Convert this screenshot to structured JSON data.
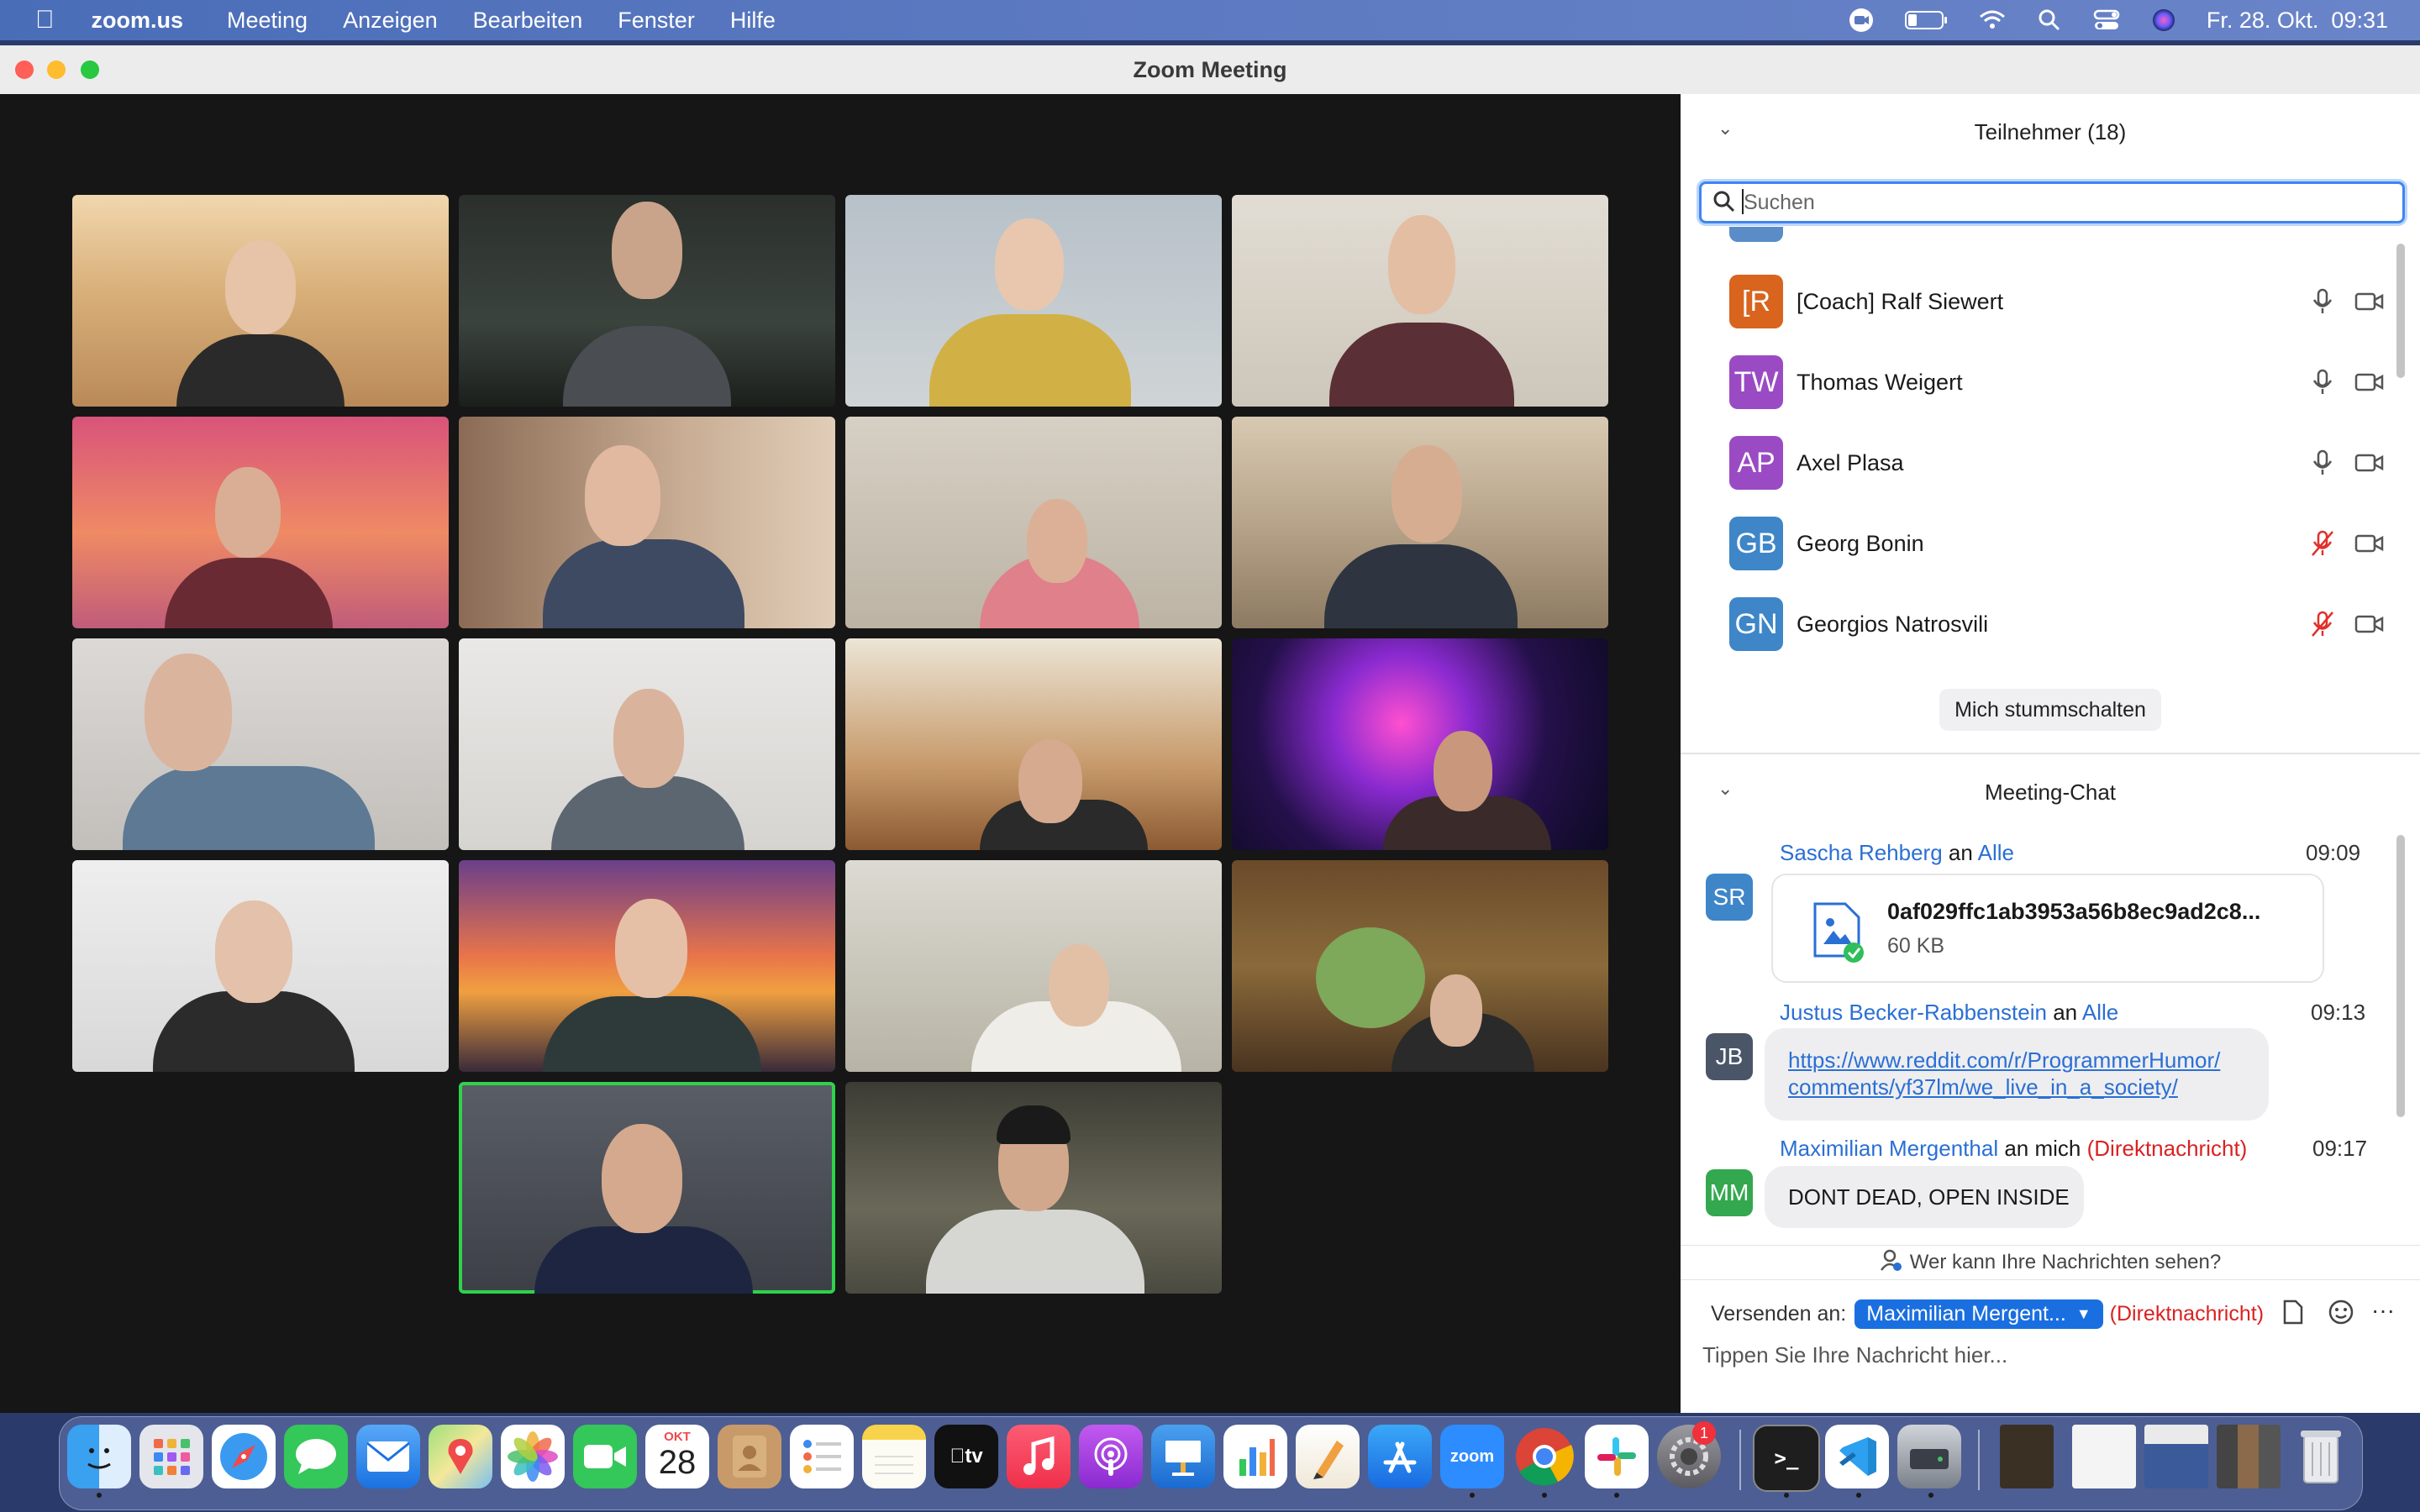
{
  "menubar": {
    "app_name": "zoom.us",
    "menus": [
      "Meeting",
      "Anzeigen",
      "Bearbeiten",
      "Fenster",
      "Hilfe"
    ],
    "clock": "Fr. 28. Okt.  09:31"
  },
  "window": {
    "title": "Zoom Meeting"
  },
  "participants_panel": {
    "title": "Teilnehmer (18)",
    "search_placeholder": "Suchen",
    "participants": [
      {
        "initials": "[R",
        "name": "[Coach] Ralf Siewert",
        "color": "#d8641e",
        "muted": false
      },
      {
        "initials": "TW",
        "name": "Thomas Weigert",
        "color": "#9a4bc4",
        "muted": false
      },
      {
        "initials": "AP",
        "name": "Axel Plasa",
        "color": "#9a4bc4",
        "muted": false
      },
      {
        "initials": "GB",
        "name": "Georg Bonin",
        "color": "#3e86c8",
        "muted": true
      },
      {
        "initials": "GN",
        "name": "Georgios Natrosvili",
        "color": "#3e86c8",
        "muted": true
      }
    ],
    "mute_button": "Mich stummschalten"
  },
  "chat": {
    "title": "Meeting-Chat",
    "messages": [
      {
        "initials": "SR",
        "sender": "Sascha Rehberg",
        "to_word": "an",
        "recipient": "Alle",
        "time": "09:09",
        "file_name": "0af029ffc1ab3953a56b8ec9ad2c8...",
        "file_size": "60 KB"
      },
      {
        "initials": "JB",
        "sender": "Justus Becker-Rabbenstein",
        "to_word": "an",
        "recipient": "Alle",
        "time": "09:13",
        "link_line1": "https://www.reddit.com/r/ProgrammerHumor/",
        "link_line2": "comments/yf37lm/we_live_in_a_society/"
      },
      {
        "initials": "MM",
        "sender": "Maximilian Mergenthal",
        "to_word": "an mich",
        "direct": "(Direktnachricht)",
        "time": "09:17",
        "text": "DONT DEAD, OPEN INSIDE"
      }
    ],
    "visibility_note": "Wer kann Ihre Nachrichten sehen?",
    "send_to_label": "Versenden an:",
    "send_to_value": "Maximilian Mergent...",
    "send_to_direct": "(Direktnachricht)",
    "input_placeholder": "Tippen Sie Ihre Nachricht hier...",
    "more": "···"
  },
  "dock": {
    "calendar_month": "OKT",
    "calendar_day": "28",
    "tv_label": "tv",
    "zoom_label": "zoom",
    "settings_badge": "1"
  }
}
